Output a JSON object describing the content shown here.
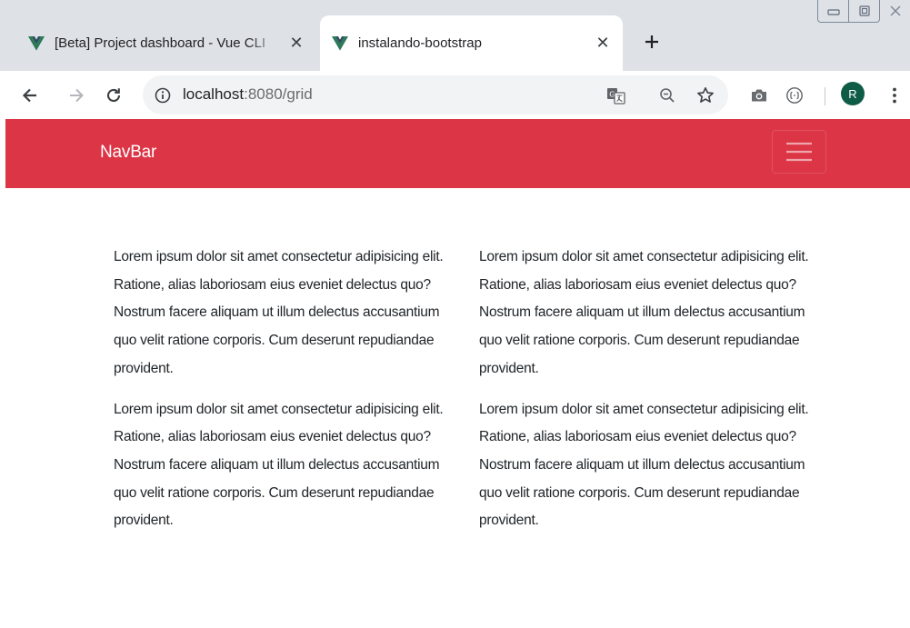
{
  "tabs": [
    {
      "title": "[Beta] Project dashboard - Vue CLI",
      "icon": "vue-logo-icon",
      "active": false
    },
    {
      "title": "instalando-bootstrap",
      "icon": "vue-logo-icon",
      "active": true
    }
  ],
  "tab_close_glyph": "✕",
  "new_tab_glyph": "+",
  "address_bar": {
    "host": "localhost",
    "path": ":8080/grid"
  },
  "avatar": {
    "initial": "R",
    "color": "#0f5c46"
  },
  "navbar": {
    "brand": "NavBar",
    "color": "#dc3545"
  },
  "paragraphs": [
    "Lorem ipsum dolor sit amet consectetur adipisicing elit. Ratione, alias laboriosam eius eveniet delectus quo? Nostrum facere aliquam ut illum delectus accusantium quo velit ratione corporis. Cum deserunt repudiandae provident.",
    "Lorem ipsum dolor sit amet consectetur adipisicing elit. Ratione, alias laboriosam eius eveniet delectus quo? Nostrum facere aliquam ut illum delectus accusantium quo velit ratione corporis. Cum deserunt repudiandae provident.",
    "Lorem ipsum dolor sit amet consectetur adipisicing elit. Ratione, alias laboriosam eius eveniet delectus quo? Nostrum facere aliquam ut illum delectus accusantium quo velit ratione corporis. Cum deserunt repudiandae provident.",
    "Lorem ipsum dolor sit amet consectetur adipisicing elit. Ratione, alias laboriosam eius eveniet delectus quo? Nostrum facere aliquam ut illum delectus accusantium quo velit ratione corporis. Cum deserunt repudiandae provident."
  ]
}
